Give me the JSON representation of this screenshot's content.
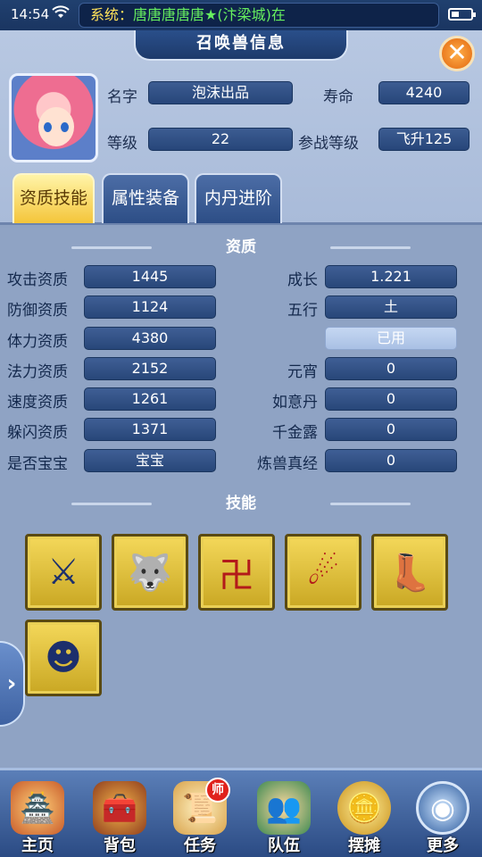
{
  "status_bar": {
    "time": "14:54",
    "marquee_label": "系统：",
    "marquee_message": "唐唐唐唐唐★(汴梁城)在"
  },
  "header": {
    "title": "召唤兽信息",
    "close_icon": "close-icon"
  },
  "pet": {
    "name_label": "名字",
    "name": "泡沫出品",
    "life_label": "寿命",
    "life": "4240",
    "level_label": "等级",
    "level": "22",
    "battle_level_label": "参战等级",
    "battle_level": "飞升125"
  },
  "tabs": [
    {
      "label": "资质技能",
      "active": true
    },
    {
      "label": "属性装备",
      "active": false
    },
    {
      "label": "内丹进阶",
      "active": false
    }
  ],
  "aptitude": {
    "section_title": "资质",
    "left": [
      {
        "label": "攻击资质",
        "value": "1445"
      },
      {
        "label": "防御资质",
        "value": "1124"
      },
      {
        "label": "体力资质",
        "value": "4380"
      },
      {
        "label": "法力资质",
        "value": "2152"
      },
      {
        "label": "速度资质",
        "value": "1261"
      },
      {
        "label": "躲闪资质",
        "value": "1371"
      },
      {
        "label": "是否宝宝",
        "value": "宝宝"
      }
    ],
    "right": [
      {
        "label": "成长",
        "value": "1.221"
      },
      {
        "label": "五行",
        "value": "土"
      },
      {
        "label": "",
        "value": "已用"
      },
      {
        "label": "元宵",
        "value": "0"
      },
      {
        "label": "如意丹",
        "value": "0"
      },
      {
        "label": "千金露",
        "value": "0"
      },
      {
        "label": "炼兽真经",
        "value": "0"
      }
    ]
  },
  "skills": {
    "section_title": "技能",
    "items": [
      {
        "icon": "crossed-swords-icon",
        "glyph": "⚔"
      },
      {
        "icon": "wolf-mountain-icon",
        "glyph": "🐺"
      },
      {
        "icon": "rune-icon",
        "glyph": "卍"
      },
      {
        "icon": "fireballs-icon",
        "glyph": "☄"
      },
      {
        "icon": "swift-boot-icon",
        "glyph": "👢"
      },
      {
        "icon": "mind-head-icon",
        "glyph": "☻"
      }
    ]
  },
  "bottom_nav": [
    {
      "label": "主页",
      "icon": "home-pavilion-icon",
      "glyph": "🏯"
    },
    {
      "label": "背包",
      "icon": "treasure-chest-icon",
      "glyph": "🧰"
    },
    {
      "label": "任务",
      "icon": "scroll-icon",
      "glyph": "📜",
      "badge": "师"
    },
    {
      "label": "队伍",
      "icon": "team-icon",
      "glyph": "👥"
    },
    {
      "label": "摆摊",
      "icon": "coin-icon",
      "glyph": "🪙"
    },
    {
      "label": "更多",
      "icon": "more-orb-icon",
      "glyph": "◉"
    }
  ]
}
